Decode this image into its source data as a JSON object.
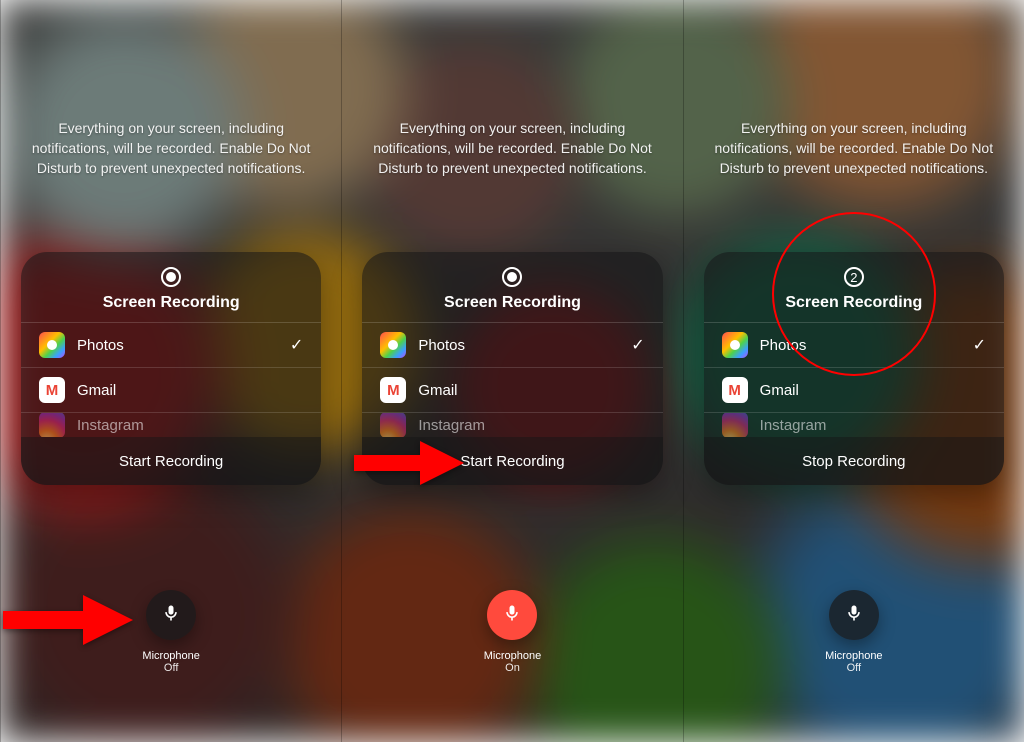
{
  "disclaimer": "Everything on your screen, including\nnotifications, will be recorded. Enable Do Not\nDisturb to prevent unexpected notifications.",
  "card": {
    "title": "Screen Recording",
    "apps": [
      {
        "label": "Photos",
        "checked": true
      },
      {
        "label": "Gmail",
        "checked": false
      },
      {
        "label": "Instagram",
        "checked": false
      }
    ]
  },
  "panels": [
    {
      "action_label": "Start Recording",
      "countdown": null,
      "mic": {
        "label": "Microphone",
        "state": "Off",
        "on": false
      },
      "arrow_target": "mic"
    },
    {
      "action_label": "Start Recording",
      "countdown": null,
      "mic": {
        "label": "Microphone",
        "state": "On",
        "on": true
      },
      "arrow_target": "start"
    },
    {
      "action_label": "Stop Recording",
      "countdown": "2",
      "mic": {
        "label": "Microphone",
        "state": "Off",
        "on": false
      },
      "arrow_target": null,
      "circle": true
    }
  ],
  "colors": {
    "arrow": "#ff0000",
    "accent": "#ff4a3d"
  }
}
